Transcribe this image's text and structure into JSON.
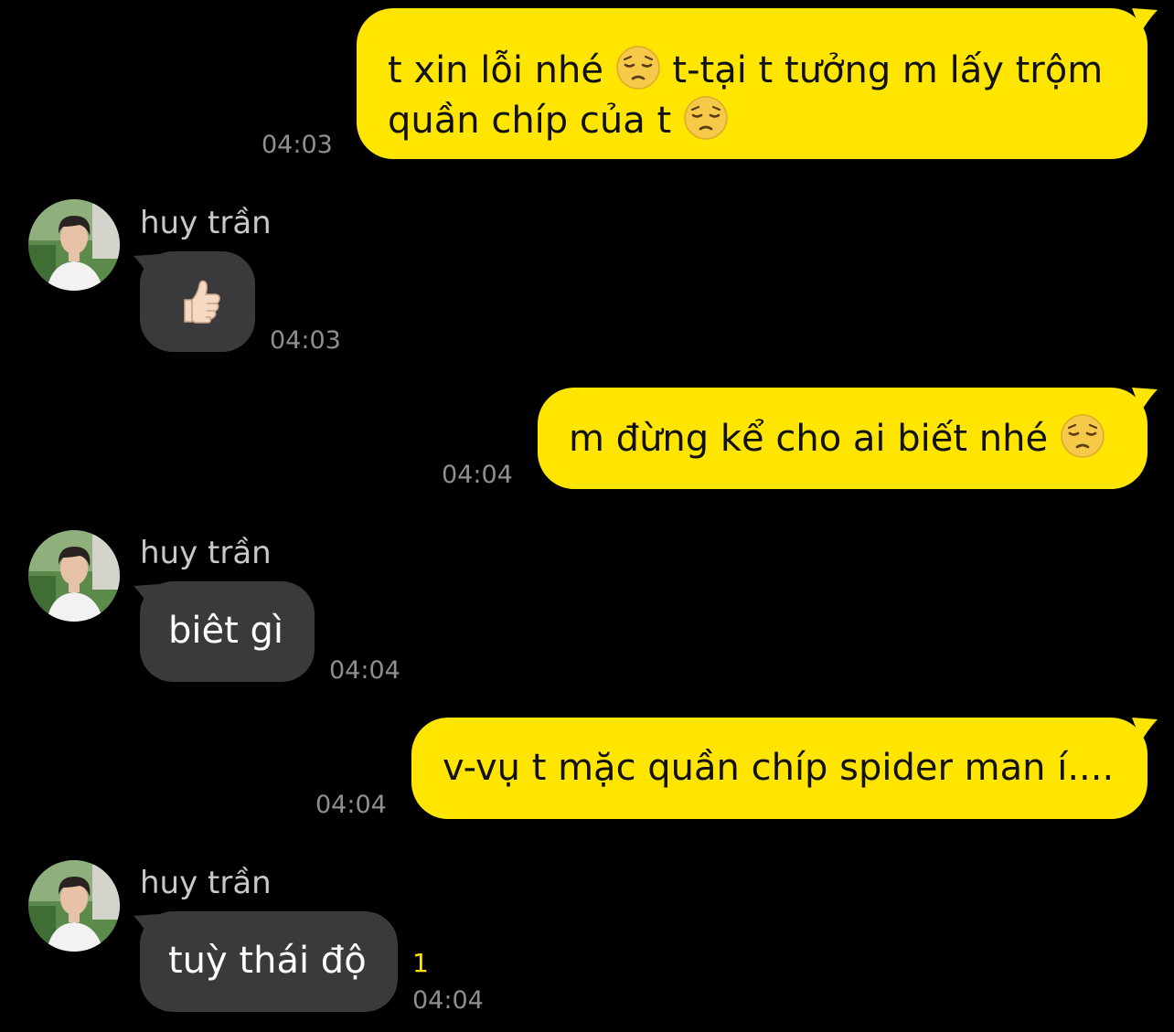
{
  "colors": {
    "background": "#000000",
    "outgoing_bubble": "#ffe500",
    "incoming_bubble": "#3a3a3c",
    "timestamp": "#8e8e93",
    "unread_count": "#ffe500"
  },
  "messages": [
    {
      "direction": "out",
      "line1": "t xin lỗi nhé ",
      "line1b": " t-tại t tưởng m lấy trộm",
      "line2": "quần chíp của t ",
      "emoji": "pensive-face-icon",
      "time": "04:03"
    },
    {
      "direction": "in",
      "sender": "huy trần",
      "emoji": "thumbs-up-icon",
      "time": "04:03"
    },
    {
      "direction": "out",
      "text": "m đừng kể cho ai biết nhé ",
      "emoji": "pensive-face-icon",
      "time": "04:04"
    },
    {
      "direction": "in",
      "sender": "huy trần",
      "text": "biêt gì",
      "time": "04:04"
    },
    {
      "direction": "out",
      "text": "v-vụ t mặc quần chíp spider man í....",
      "time": "04:04"
    },
    {
      "direction": "in",
      "sender": "huy trần",
      "text": "tuỳ thái độ",
      "unread": "1",
      "time": "04:04"
    }
  ]
}
